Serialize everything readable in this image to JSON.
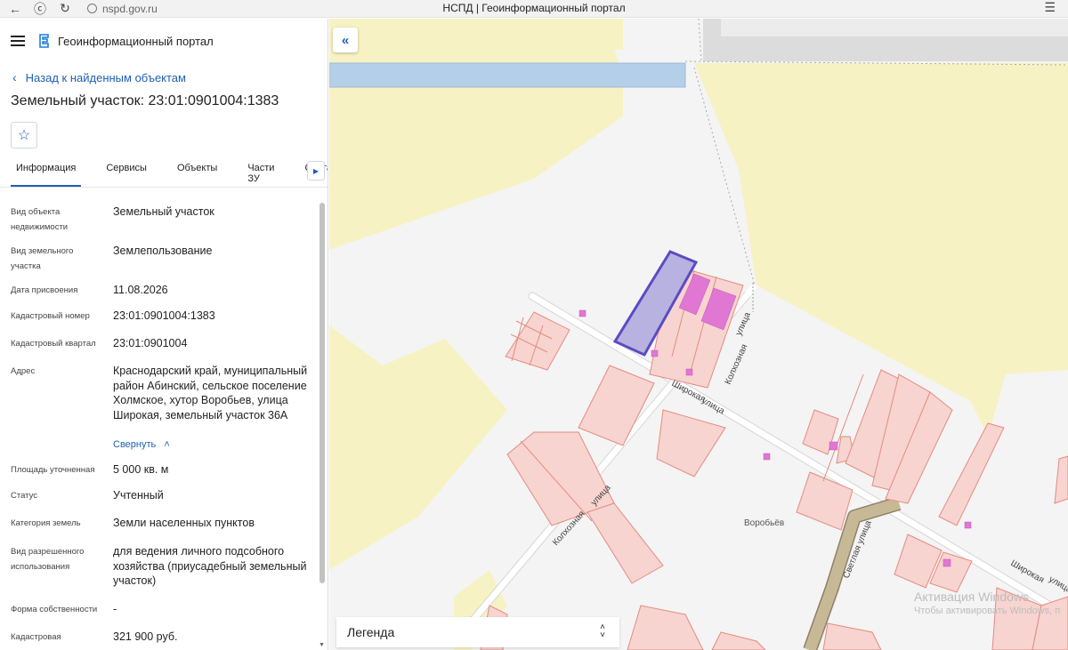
{
  "browser": {
    "url": "nspd.gov.ru",
    "tab_title": "НСПД | Геоинформационный портал"
  },
  "header": {
    "portal_title": "Геоинформационный портал"
  },
  "back_link": "Назад к найденным объектам",
  "object_title": "Земельный участок: 23:01:0901004:1383",
  "tabs": [
    "Информация",
    "Сервисы",
    "Объекты",
    "Части ЗУ",
    "Состав"
  ],
  "properties": [
    {
      "label": "Вид объекта недвижимости",
      "value": "Земельный участок"
    },
    {
      "label": "Вид земельного участка",
      "value": "Землепользование"
    },
    {
      "label": "Дата присвоения",
      "value": "11.08.2026"
    },
    {
      "label": "Кадастровый номер",
      "value": "23:01:0901004:1383"
    },
    {
      "label": "Кадастровый квартал",
      "value": "23:01:0901004"
    },
    {
      "label": "Адрес",
      "value": "Краснодарский край, муниципальный район Абинский, сельское поселение Холмское, хутор Воробьев, улица Широкая, земельный участок 36А"
    },
    {
      "label": "Площадь уточненная",
      "value": "5 000 кв. м"
    },
    {
      "label": "Статус",
      "value": "Учтенный"
    },
    {
      "label": "Категория земель",
      "value": "Земли населенных пунктов"
    },
    {
      "label": "Вид разрешенного использования",
      "value": "для ведения личного подсобного хозяйства (приусадебный земельный участок)"
    },
    {
      "label": "Форма собственности",
      "value": "-"
    },
    {
      "label": "Кадастровая",
      "value": "321 900 руб."
    }
  ],
  "collapse_label": "Свернуть",
  "map": {
    "street_labels": [
      "Широкая",
      "улица",
      "Колхозная",
      "улица",
      "Колхозная",
      "улица",
      "Светлая улица",
      "Широкая",
      "улица"
    ],
    "place_label": "Воробьёв",
    "legend_label": "Легенда"
  },
  "watermark": {
    "line1": "Активация Windows",
    "line2": "Чтобы активировать Windows, п"
  },
  "colors": {
    "accent": "#1f5fb3",
    "selected_parcel": "#5b4bc4",
    "parcel_outline": "#e68a80",
    "zone_yellow": "#f7f2c4",
    "water": "#b4cfe8"
  }
}
